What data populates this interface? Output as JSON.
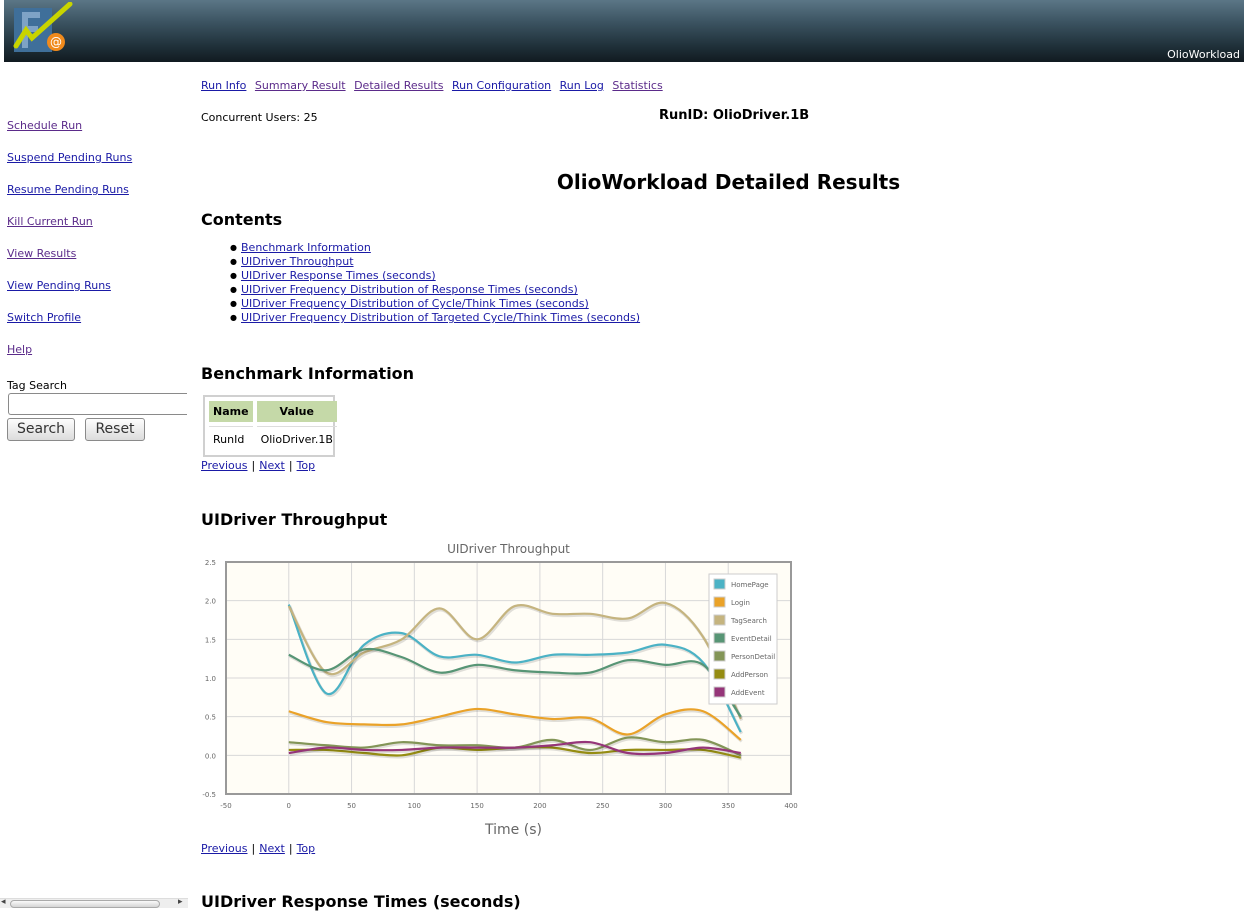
{
  "header": {
    "brand": "OlioWorkload",
    "logo_text": "F@"
  },
  "sidebar": {
    "links": [
      {
        "label": "Schedule Run",
        "name": "sidebar-schedule-run",
        "visited": true
      },
      {
        "label": "Suspend Pending Runs",
        "name": "sidebar-suspend-pending-runs",
        "visited": false
      },
      {
        "label": "Resume Pending Runs",
        "name": "sidebar-resume-pending-runs",
        "visited": false
      },
      {
        "label": "Kill Current Run",
        "name": "sidebar-kill-current-run",
        "visited": true
      },
      {
        "label": "View Results",
        "name": "sidebar-view-results",
        "visited": true
      },
      {
        "label": "View Pending Runs",
        "name": "sidebar-view-pending-runs",
        "visited": false
      },
      {
        "label": "Switch Profile",
        "name": "sidebar-switch-profile",
        "visited": false
      },
      {
        "label": "Help",
        "name": "sidebar-help",
        "visited": true
      }
    ],
    "tag_search": {
      "label": "Tag Search",
      "value": "",
      "search_button": "Search",
      "reset_button": "Reset"
    }
  },
  "top_nav": [
    {
      "label": "Run Info",
      "visited": false
    },
    {
      "label": "Summary Result",
      "visited": true
    },
    {
      "label": "Detailed Results",
      "visited": true
    },
    {
      "label": "Run Configuration",
      "visited": false
    },
    {
      "label": "Run Log",
      "visited": false
    },
    {
      "label": "Statistics",
      "visited": true
    }
  ],
  "run": {
    "concurrent_label": "Concurrent Users:",
    "concurrent_value": "25",
    "run_id_text": "RunID: OlioDriver.1B"
  },
  "page_title": "OlioWorkload Detailed Results",
  "contents": {
    "heading": "Contents",
    "items": [
      "Benchmark Information",
      "UIDriver Throughput",
      "UIDriver Response Times (seconds)",
      "UIDriver Frequency Distribution of Response Times (seconds)",
      "UIDriver Frequency Distribution of Cycle/Think Times (seconds)",
      "UIDriver Frequency Distribution of Targeted Cycle/Think Times (seconds)"
    ]
  },
  "benchmark_info": {
    "heading": "Benchmark Information",
    "columns": [
      "Name",
      "Value"
    ],
    "rows": [
      [
        "RunId",
        "OlioDriver.1B"
      ]
    ]
  },
  "section_nav": {
    "previous": "Previous",
    "next": "Next",
    "top": "Top",
    "separator": "|"
  },
  "throughput": {
    "heading": "UIDriver Throughput"
  },
  "response_times": {
    "heading": "UIDriver Response Times (seconds)"
  },
  "colors": {
    "plot_bg": "#fffdf6",
    "grid": "#d8d8d8",
    "table_header": "#c5d9a8"
  },
  "chart_data": {
    "type": "line",
    "title": "UIDriver Throughput",
    "xlabel": "Time (s)",
    "ylabel": "",
    "xlim": [
      -50,
      400
    ],
    "ylim": [
      -0.5,
      2.5
    ],
    "xticks": [
      -50,
      0,
      50,
      100,
      150,
      200,
      250,
      300,
      350,
      400
    ],
    "yticks": [
      -0.5,
      0.0,
      0.5,
      1.0,
      1.5,
      2.0,
      2.5
    ],
    "grid": true,
    "legend_position": "top-right",
    "x": [
      0,
      30,
      60,
      90,
      120,
      150,
      180,
      210,
      240,
      270,
      300,
      330,
      360
    ],
    "series": [
      {
        "name": "HomePage",
        "color": "#4bb2c5",
        "values": [
          1.95,
          0.8,
          1.43,
          1.58,
          1.28,
          1.3,
          1.2,
          1.3,
          1.3,
          1.33,
          1.43,
          1.2,
          0.3
        ]
      },
      {
        "name": "Login",
        "color": "#eaa228",
        "values": [
          0.57,
          0.43,
          0.4,
          0.4,
          0.5,
          0.6,
          0.53,
          0.47,
          0.48,
          0.27,
          0.53,
          0.57,
          0.2
        ]
      },
      {
        "name": "TagSearch",
        "color": "#c5b47f",
        "values": [
          1.93,
          1.07,
          1.33,
          1.5,
          1.9,
          1.5,
          1.93,
          1.83,
          1.83,
          1.77,
          1.97,
          1.53,
          0.47
        ]
      },
      {
        "name": "EventDetail",
        "color": "#579575",
        "values": [
          1.3,
          1.1,
          1.37,
          1.27,
          1.07,
          1.17,
          1.1,
          1.07,
          1.07,
          1.23,
          1.17,
          1.17,
          0.5
        ]
      },
      {
        "name": "PersonDetail",
        "color": "#839557",
        "values": [
          0.17,
          0.13,
          0.1,
          0.17,
          0.13,
          0.13,
          0.1,
          0.2,
          0.07,
          0.23,
          0.17,
          0.2,
          0.0
        ]
      },
      {
        "name": "AddPerson",
        "color": "#958c12",
        "values": [
          0.07,
          0.07,
          0.03,
          0.0,
          0.1,
          0.07,
          0.1,
          0.1,
          0.03,
          0.07,
          0.07,
          0.07,
          -0.03
        ]
      },
      {
        "name": "AddEvent",
        "color": "#953579",
        "values": [
          0.03,
          0.1,
          0.07,
          0.07,
          0.1,
          0.1,
          0.1,
          0.13,
          0.17,
          0.03,
          0.03,
          0.1,
          0.03
        ]
      }
    ]
  }
}
